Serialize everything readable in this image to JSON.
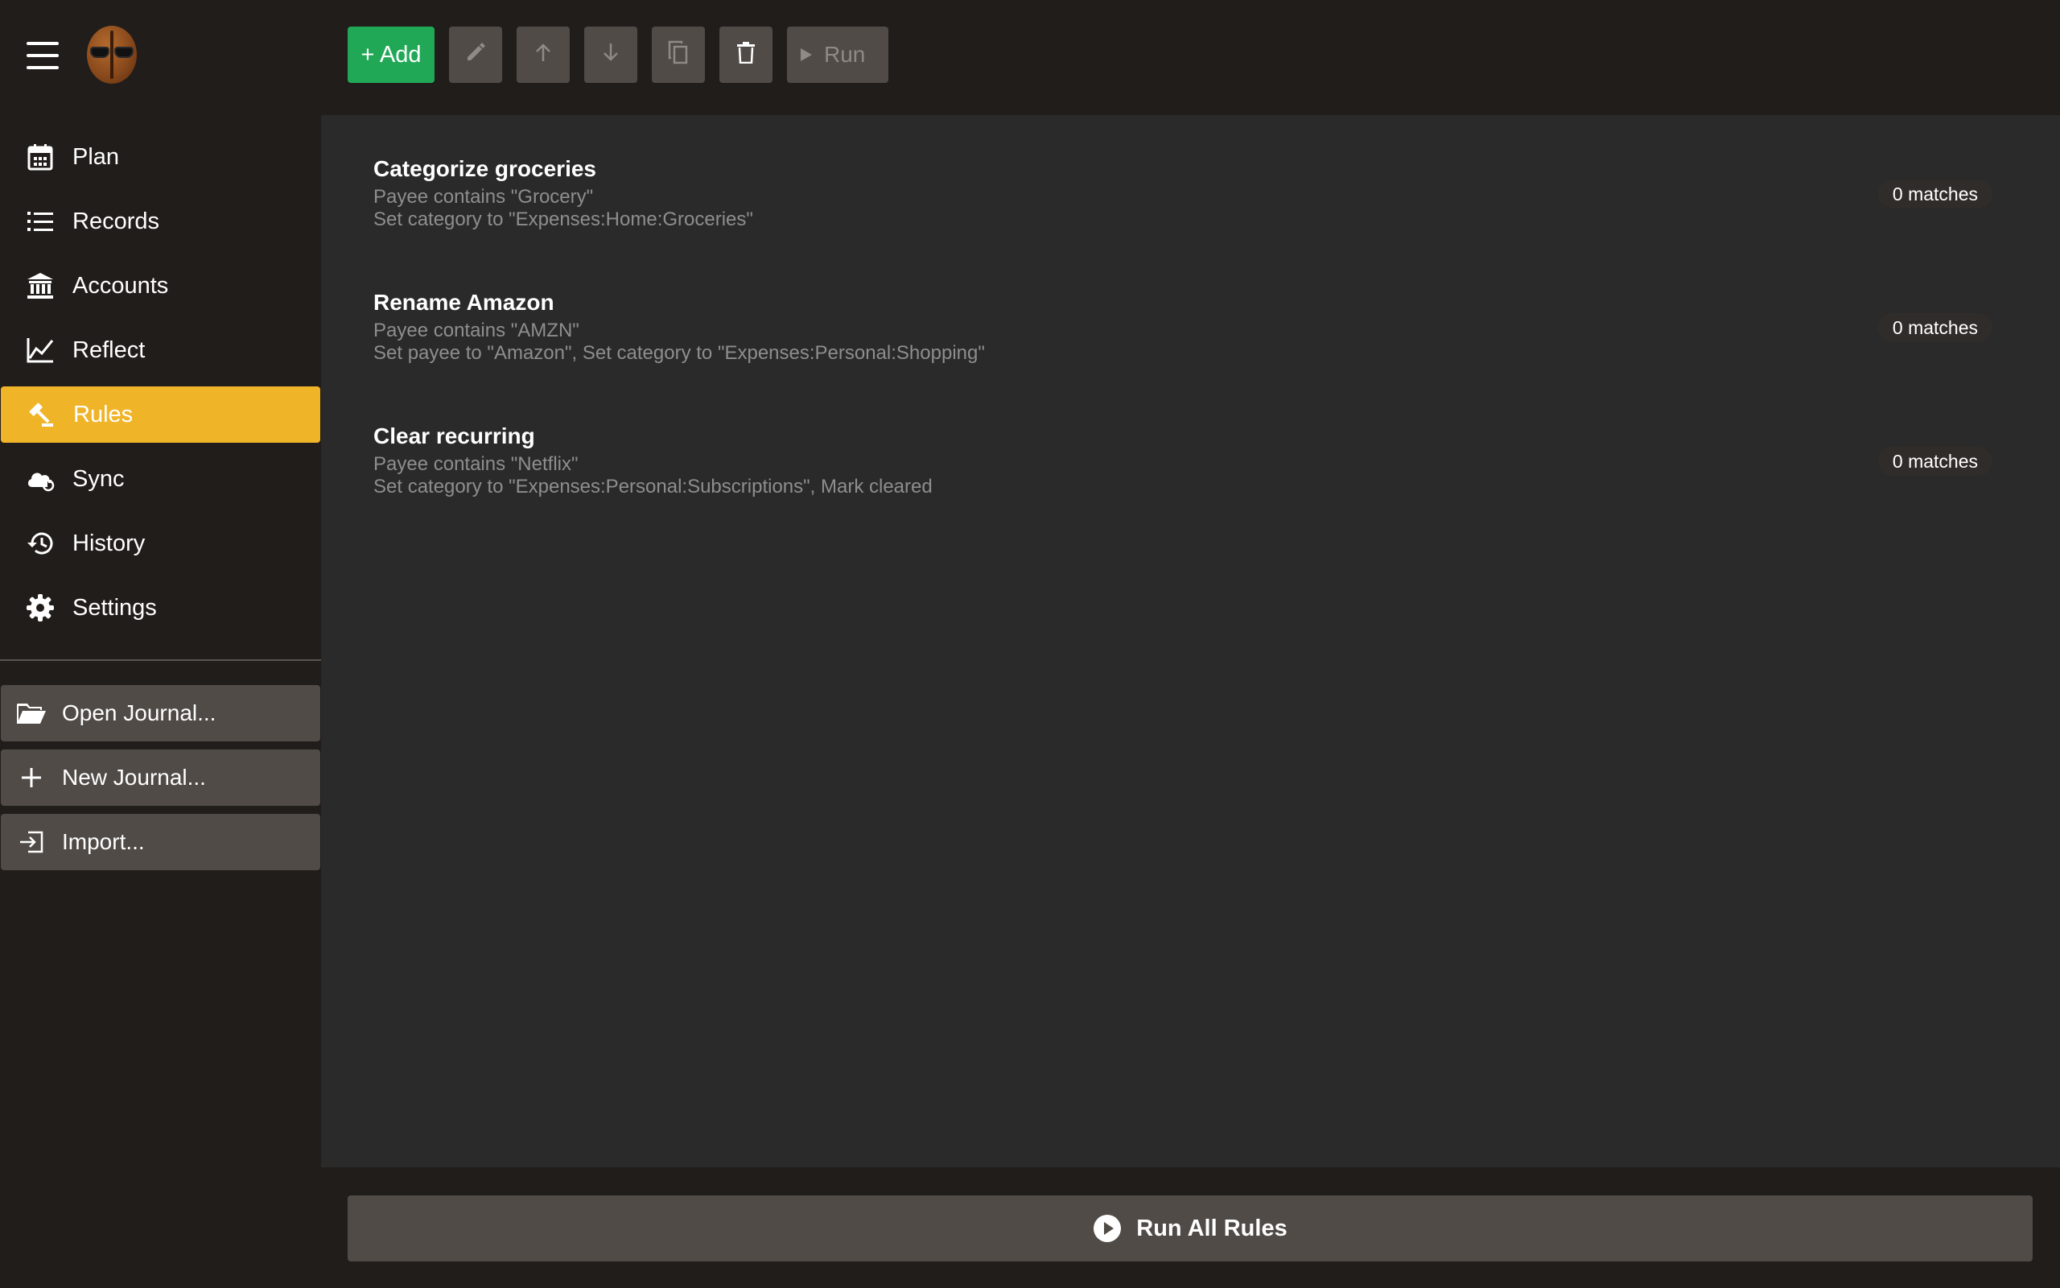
{
  "sidebar": {
    "nav": [
      {
        "label": "Plan",
        "icon": "calendar-icon"
      },
      {
        "label": "Records",
        "icon": "list-icon"
      },
      {
        "label": "Accounts",
        "icon": "bank-icon"
      },
      {
        "label": "Reflect",
        "icon": "line-chart-icon"
      },
      {
        "label": "Rules",
        "icon": "gavel-icon",
        "active": true
      },
      {
        "label": "Sync",
        "icon": "cloud-sync-icon"
      },
      {
        "label": "History",
        "icon": "history-icon"
      },
      {
        "label": "Settings",
        "icon": "gear-icon"
      }
    ],
    "actions": [
      {
        "label": "Open Journal...",
        "icon": "folder-open-icon"
      },
      {
        "label": "New Journal...",
        "icon": "plus-icon"
      },
      {
        "label": "Import...",
        "icon": "import-icon"
      }
    ]
  },
  "toolbar": {
    "add_label": "+ Add",
    "run_label": "Run"
  },
  "rules": [
    {
      "name": "Categorize groceries",
      "condition": "Payee contains \"Grocery\"",
      "actions": "Set category to \"Expenses:Home:Groceries\"",
      "matches": "0 matches"
    },
    {
      "name": "Rename Amazon",
      "condition": "Payee contains \"AMZN\"",
      "actions": "Set payee to \"Amazon\", Set category to \"Expenses:Personal:Shopping\"",
      "matches": "0 matches"
    },
    {
      "name": "Clear recurring",
      "condition": "Payee contains \"Netflix\"",
      "actions": "Set category to \"Expenses:Personal:Subscriptions\", Mark cleared",
      "matches": "0 matches"
    }
  ],
  "footer": {
    "run_all_label": "Run All Rules"
  },
  "colors": {
    "accent": "#f0b429",
    "add_button": "#21a857",
    "sidebar_bg": "#211d1a",
    "main_bg": "#2a2a2a",
    "button_bg": "#504b47"
  }
}
